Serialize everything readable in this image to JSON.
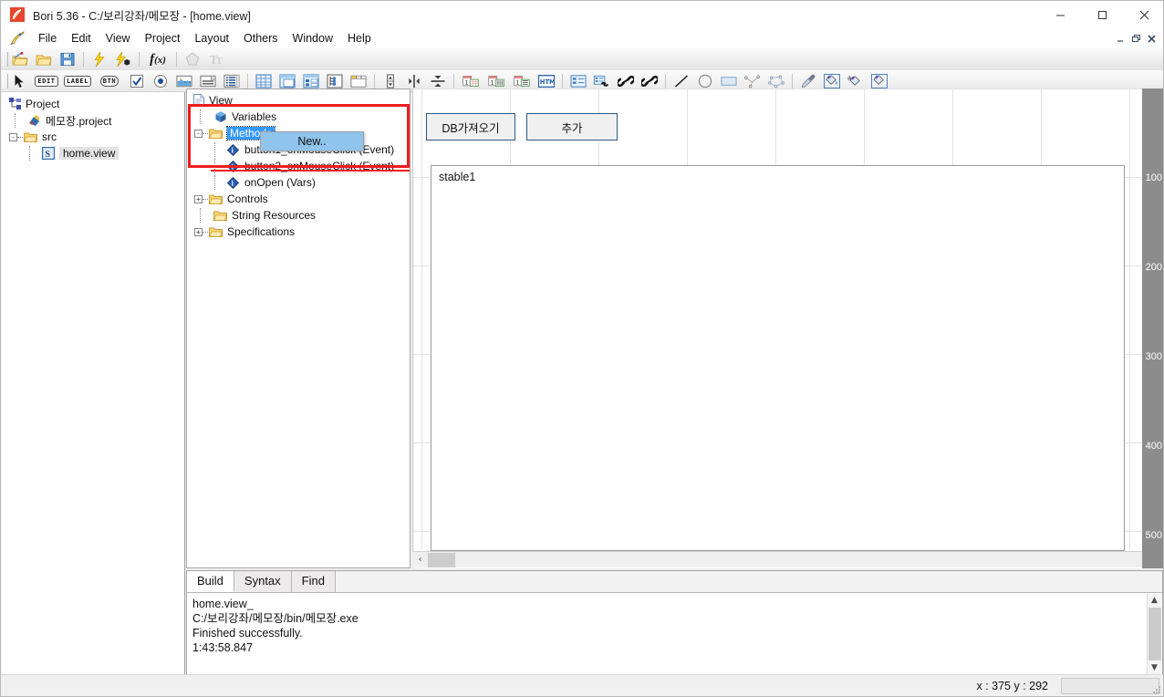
{
  "window": {
    "title": "Bori 5.36 - C:/보리강좌/메모장 - [home.view]",
    "app_icon": "feather-icon",
    "controls": {
      "minimize": "–",
      "maximize": "◻",
      "close": "✕"
    },
    "mdi_controls": {
      "minimize": "–",
      "restore": "❐",
      "close": "✕"
    }
  },
  "menubar": {
    "icon": "feather-pen-icon",
    "items": [
      "File",
      "Edit",
      "View",
      "Project",
      "Layout",
      "Others",
      "Window",
      "Help"
    ]
  },
  "toolbar_row1": [
    {
      "name": "open-project-icon",
      "type": "folder-pencil"
    },
    {
      "name": "open-folder-icon",
      "type": "folder"
    },
    {
      "name": "save-icon",
      "type": "floppy"
    },
    {
      "name": "separator",
      "type": "sep"
    },
    {
      "name": "run-icon",
      "type": "bolt"
    },
    {
      "name": "debug-icon",
      "type": "bolt-bug"
    },
    {
      "name": "separator",
      "type": "sep"
    },
    {
      "name": "function-icon",
      "type": "fx"
    },
    {
      "name": "separator",
      "type": "sep"
    },
    {
      "name": "shape-icon",
      "type": "pentagon-disabled"
    },
    {
      "name": "text-format-icon",
      "type": "tt-disabled"
    }
  ],
  "toolbar_row2": [
    {
      "name": "separator",
      "type": "sep"
    },
    {
      "name": "pointer-tool-icon",
      "type": "cursor"
    },
    {
      "name": "edit-control-icon",
      "type": "text",
      "text": "EDIT"
    },
    {
      "name": "label-control-icon",
      "type": "text",
      "text": "LABEL"
    },
    {
      "name": "button-control-icon",
      "type": "text",
      "text": "BTN"
    },
    {
      "name": "checkbox-control-icon",
      "type": "checkbox"
    },
    {
      "name": "radio-control-icon",
      "type": "radio"
    },
    {
      "name": "image-control-icon",
      "type": "image"
    },
    {
      "name": "combobox-control-icon",
      "type": "combo"
    },
    {
      "name": "listbox-control-icon",
      "type": "listbox"
    },
    {
      "name": "separator",
      "type": "sep"
    },
    {
      "name": "grid-control-icon",
      "type": "grid"
    },
    {
      "name": "table-control-icon",
      "type": "table"
    },
    {
      "name": "treegrid-control-icon",
      "type": "treegrid"
    },
    {
      "name": "tree-control-icon",
      "type": "tree"
    },
    {
      "name": "tab-control-icon",
      "type": "tab"
    },
    {
      "name": "separator",
      "type": "sep"
    },
    {
      "name": "spinner-control-icon",
      "type": "spinner"
    },
    {
      "name": "vertical-split-icon",
      "type": "vsplit"
    },
    {
      "name": "horizontal-split-icon",
      "type": "hsplit"
    },
    {
      "name": "separator",
      "type": "sep"
    },
    {
      "name": "dataset-grid-icon",
      "type": "ds-grid"
    },
    {
      "name": "dataset-columns-icon",
      "type": "ds-col"
    },
    {
      "name": "dataset-list-icon",
      "type": "ds-list"
    },
    {
      "name": "html-control-icon",
      "type": "html"
    },
    {
      "name": "separator",
      "type": "sep"
    },
    {
      "name": "property-list-icon",
      "type": "proplist"
    },
    {
      "name": "binding-icon",
      "type": "binding"
    },
    {
      "name": "link-icon",
      "type": "link"
    },
    {
      "name": "link-alt-icon",
      "type": "link2"
    },
    {
      "name": "separator",
      "type": "sep"
    },
    {
      "name": "line-tool-icon",
      "type": "line"
    },
    {
      "name": "ellipse-tool-icon",
      "type": "ellipse"
    },
    {
      "name": "rect-tool-icon",
      "type": "rect"
    },
    {
      "name": "polyline-tool-icon",
      "type": "polyline"
    },
    {
      "name": "polygon-tool-icon",
      "type": "polygon"
    },
    {
      "name": "separator",
      "type": "sep"
    },
    {
      "name": "eyedropper-icon",
      "type": "dropper"
    },
    {
      "name": "fill-color-icon",
      "type": "bucket"
    },
    {
      "name": "text-color-icon",
      "type": "bucket-a"
    },
    {
      "name": "border-color-icon",
      "type": "bucket2"
    }
  ],
  "project_tree": {
    "root": "Project",
    "nodes": [
      {
        "label": "Project",
        "icon": "project-icon",
        "depth": 0,
        "expander": ""
      },
      {
        "label": "메모장.project",
        "icon": "project-file-icon",
        "depth": 1,
        "expander": ""
      },
      {
        "label": "src",
        "icon": "folder-icon",
        "depth": 1,
        "expander": "-"
      },
      {
        "label": "home.view",
        "icon": "view-file-icon",
        "depth": 2,
        "expander": "",
        "selected": true
      }
    ]
  },
  "view_tree": {
    "nodes": [
      {
        "label": "View",
        "icon": "document-icon",
        "depth": 0,
        "expander": ""
      },
      {
        "label": "Variables",
        "icon": "variables-icon",
        "depth": 1,
        "expander": ""
      },
      {
        "label": "Methods",
        "icon": "folder-icon",
        "depth": 1,
        "expander": "-",
        "selected": true
      },
      {
        "label": "button1_onMouseClick (Event)",
        "icon": "method-icon",
        "depth": 2,
        "expander": ""
      },
      {
        "label": "button2_onMouseClick (Event)",
        "icon": "method-icon",
        "depth": 2,
        "expander": ""
      },
      {
        "label": "onOpen (Vars)",
        "icon": "method-icon",
        "depth": 2,
        "expander": ""
      },
      {
        "label": "Controls",
        "icon": "folder-icon",
        "depth": 1,
        "expander": "+"
      },
      {
        "label": "String Resources",
        "icon": "folder-icon",
        "depth": 1,
        "expander": ""
      },
      {
        "label": "Specifications",
        "icon": "folder-icon",
        "depth": 1,
        "expander": "+"
      }
    ]
  },
  "context_menu": {
    "items": [
      {
        "label": "New..",
        "selected": true
      }
    ]
  },
  "canvas": {
    "buttons": [
      {
        "label": "DB가져오기",
        "name": "db-import-button"
      },
      {
        "label": "추가",
        "name": "add-button"
      }
    ],
    "table": {
      "label": "stable1",
      "name": "stable1-table"
    },
    "ruler_ticks": [
      "100",
      "200",
      "300",
      "400",
      "500"
    ],
    "hscroll_arrow": "‹"
  },
  "output": {
    "tabs": [
      {
        "label": "Build",
        "active": true
      },
      {
        "label": "Syntax",
        "active": false
      },
      {
        "label": "Find",
        "active": false
      }
    ],
    "lines": [
      "home.view_",
      "C:/보리강좌/메모장/bin/메모장.exe",
      "Finished successfully.",
      "1:43:58.847"
    ],
    "scroll_up": "▲",
    "scroll_down": "▼"
  },
  "statusbar": {
    "coords": "x : 375  y : 292"
  },
  "colors": {
    "annotation_red": "#ee1c1c",
    "selection_blue": "#3399ff",
    "menu_highlight": "#8fc4ec",
    "ruler_gray": "#8c8c8c"
  }
}
